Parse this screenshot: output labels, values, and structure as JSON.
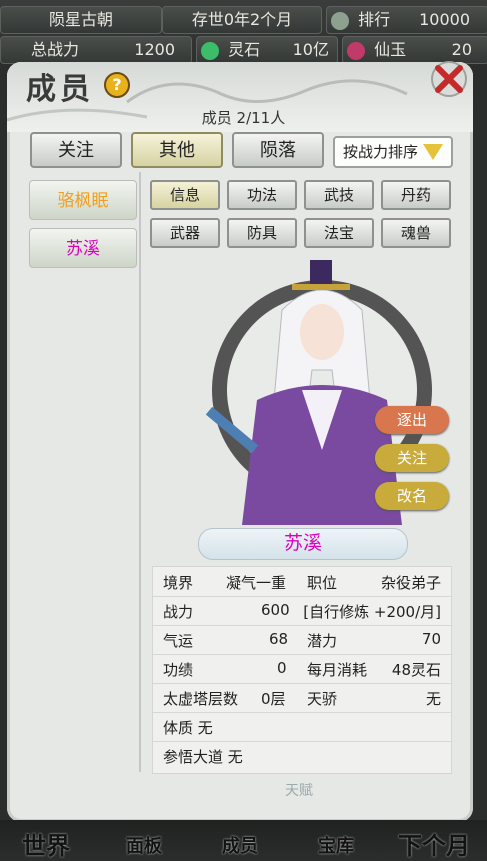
{
  "topbar": {
    "world": "陨星古朝",
    "time": "存世0年2个月",
    "rank_label": "排行",
    "rank_value": "10000",
    "power_label": "总战力",
    "power_value": "1200",
    "stone_label": "灵石",
    "stone_value": "10亿",
    "jade_label": "仙玉",
    "jade_value": "20"
  },
  "dialog": {
    "title": "成员",
    "help": "?",
    "count": "成员 2/11人"
  },
  "tabs": [
    {
      "label": "关注",
      "active": false
    },
    {
      "label": "其他",
      "active": true
    },
    {
      "label": "陨落",
      "active": false
    }
  ],
  "sort_label": "按战力排序",
  "members": [
    {
      "name": "骆枫眠",
      "color": "#f0a020"
    },
    {
      "name": "苏溪",
      "color": "#d900c0"
    }
  ],
  "subtabs": [
    {
      "label": "信息",
      "active": true
    },
    {
      "label": "功法",
      "active": false
    },
    {
      "label": "武技",
      "active": false
    },
    {
      "label": "丹药",
      "active": false
    },
    {
      "label": "武器",
      "active": false
    },
    {
      "label": "防具",
      "active": false
    },
    {
      "label": "法宝",
      "active": false
    },
    {
      "label": "魂兽",
      "active": false
    }
  ],
  "actions": [
    {
      "label": "逐出",
      "color": "#d8764e"
    },
    {
      "label": "关注",
      "color": "#c9ab3c"
    },
    {
      "label": "改名",
      "color": "#c9ab3c"
    }
  ],
  "selected_name": "苏溪",
  "stats": {
    "realm_label": "境界",
    "realm_value": "凝气一重",
    "post_label": "职位",
    "post_value": "杂役弟子",
    "power_label": "战力",
    "power_value": "600",
    "cultivate_value": "[自行修炼 +200/月]",
    "luck_label": "气运",
    "luck_value": "68",
    "potential_label": "潜力",
    "potential_value": "70",
    "merit_label": "功绩",
    "merit_value": "0",
    "cost_label": "每月消耗",
    "cost_value": "48灵石",
    "tower_label": "太虚塔层数",
    "tower_value": "0层",
    "genius_label": "天骄",
    "genius_value": "无",
    "body": "体质 无",
    "dao": "参悟大道 无"
  },
  "ghost_text": "天赋",
  "footer": {
    "world": "世界",
    "panel": "面板",
    "members": "成员",
    "treasury": "宝库",
    "next_month": "下个月"
  }
}
